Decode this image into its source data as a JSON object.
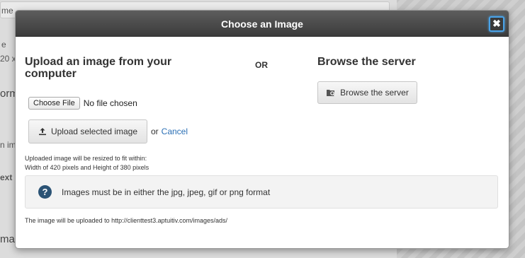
{
  "background": {
    "fragments": [
      "me – ",
      "e",
      "20 x",
      "orm",
      "n im",
      "ext",
      "ma"
    ]
  },
  "modal": {
    "title": "Choose an Image",
    "close_label": "✖",
    "upload": {
      "heading": "Upload an image from your computer",
      "choose_file_label": "Choose File",
      "file_status": "No file chosen",
      "upload_button_label": "Upload selected image",
      "or_text": "or",
      "cancel_label": "Cancel",
      "resize_note_line1": "Uploaded image will be resized to fit within:",
      "resize_note_line2": "Width of 420 pixels and Height of 380 pixels"
    },
    "or_label": "OR",
    "browse": {
      "heading": "Browse the server",
      "button_label": "Browse the server"
    },
    "info": {
      "icon_glyph": "?",
      "text": "Images must be in either the jpg, jpeg, gif or png format"
    },
    "upload_destination": "The image will be uploaded to http://clienttest3.aptuitiv.com/images/ads/"
  },
  "colors": {
    "header_bg": "#3b3b3b",
    "link": "#2a6fb5",
    "help_icon": "#2b5375",
    "focus_ring": "#4aa3e8"
  }
}
